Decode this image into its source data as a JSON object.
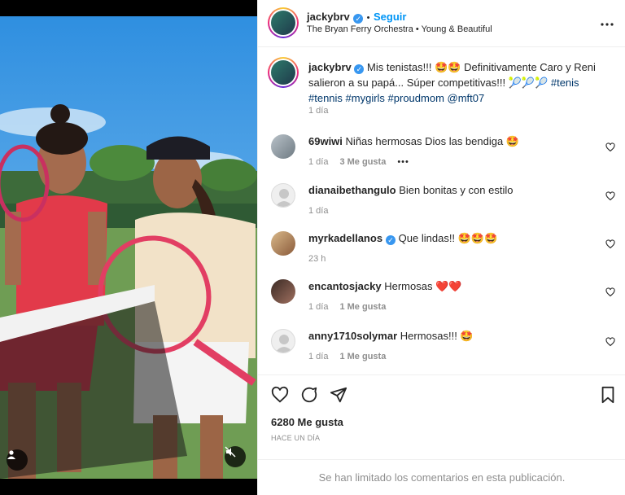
{
  "header": {
    "username": "jackybrv",
    "dot": "•",
    "follow_label": "Seguir",
    "audio_artist": "The Bryan Ferry Orchestra",
    "audio_sep": "•",
    "audio_track": "Young & Beautiful",
    "more_icon": "more-horizontal-icon"
  },
  "caption": {
    "username": "jackybrv",
    "text_part1": "Mis tenistas!!! 🤩🤩 Definitivamente Caro y Reni salieron a su papá... Súper competitivas!!! 🎾🎾🎾 ",
    "tags": "#tenis #tennis #mygirls #proudmom @mft07",
    "time": "1 día"
  },
  "comments": [
    {
      "username": "69wiwi",
      "text": "Niñas hermosas Dios las bendiga 🤩",
      "time": "1 día",
      "likes": "3 Me gusta",
      "more": "•••",
      "verified": false
    },
    {
      "username": "dianaibethangulo",
      "text": "Bien bonitas y con estilo",
      "time": "1 día",
      "likes": "",
      "more": "",
      "verified": false
    },
    {
      "username": "myrkadellanos",
      "text": "Que lindas!! 🤩🤩🤩",
      "time": "23 h",
      "likes": "",
      "more": "",
      "verified": true
    },
    {
      "username": "encantosjacky",
      "text": "Hermosas ❤️❤️",
      "time": "1 día",
      "likes": "1 Me gusta",
      "more": "",
      "verified": false
    },
    {
      "username": "anny1710solymar",
      "text": "Hermosas!!! 🤩",
      "time": "1 día",
      "likes": "1 Me gusta",
      "more": "",
      "verified": false
    }
  ],
  "actions": {
    "like_icon": "heart-icon",
    "comment_icon": "comment-icon",
    "share_icon": "paper-plane-icon",
    "save_icon": "bookmark-icon"
  },
  "likes_count": "6280 Me gusta",
  "post_time": "HACE UN DÍA",
  "comments_limited": "Se han limitado los comentarios en esta publicación.",
  "colors": {
    "accent": "#0095f6",
    "verified": "#3897f0",
    "link": "#00376b",
    "muted": "#8e8e8e"
  }
}
